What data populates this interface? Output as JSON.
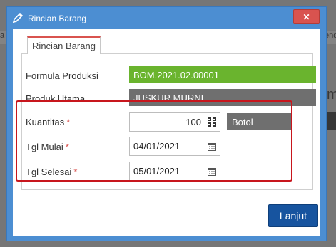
{
  "background": {
    "left_fragment": "a",
    "right_fragment": "end",
    "big_fragment": "m"
  },
  "dialog": {
    "title": "Rincian Barang",
    "title_icon": "pencil-icon",
    "close_symbol": "✕",
    "tab_label": "Rincian Barang",
    "fields": {
      "formula_label": "Formula Produksi",
      "formula_value": "BOM.2021.02.00001",
      "produk_label": "Produk Utama",
      "produk_value": "JUSKUR MURNI",
      "kuantitas_label": "Kuantitas",
      "kuantitas_value": "100",
      "kuantitas_unit": "Botol",
      "tgl_mulai_label": "Tgl Mulai",
      "tgl_mulai_value": "04/01/2021",
      "tgl_selesai_label": "Tgl Selesai",
      "tgl_selesai_value": "05/01/2021",
      "required_marker": "*"
    },
    "primary_button": "Lanjut"
  },
  "colors": {
    "dialog_header": "#4c8ed2",
    "close_button": "#d9534f",
    "readonly_green": "#6ab42e",
    "readonly_gray": "#6f6f6f",
    "primary_button": "#17549f",
    "highlight_border": "#c8161d"
  }
}
